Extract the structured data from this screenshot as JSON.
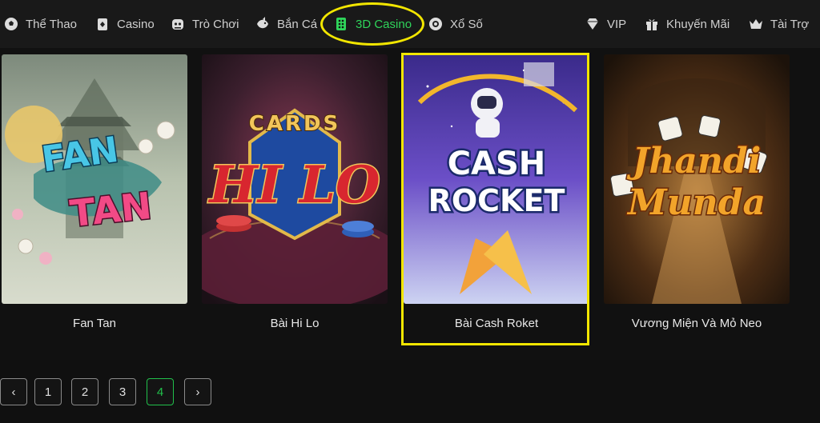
{
  "nav": {
    "items": [
      {
        "label": "Thể Thao",
        "icon": "soccer-ball-icon"
      },
      {
        "label": "Casino",
        "icon": "cards-icon"
      },
      {
        "label": "Trò Chơi",
        "icon": "gamepad-icon"
      },
      {
        "label": "Bắn Cá",
        "icon": "fish-icon"
      },
      {
        "label": "3D Casino",
        "icon": "dice-icon",
        "active": true
      },
      {
        "label": "Xổ Số",
        "icon": "lottery-ball-icon"
      }
    ],
    "right_items": [
      {
        "label": "VIP",
        "icon": "diamond-icon"
      },
      {
        "label": "Khuyến Mãi",
        "icon": "gift-icon"
      },
      {
        "label": "Tài Trợ",
        "icon": "crown-icon"
      }
    ]
  },
  "games": [
    {
      "name": "Fan Tan",
      "art_title": "FAN TAN"
    },
    {
      "name": "Bài Hi Lo",
      "art_title_top": "CARDS",
      "art_title": "HI LO"
    },
    {
      "name": "Bài Cash Roket",
      "art_title": "CASH ROCKET",
      "selected": true
    },
    {
      "name": "Vương Miện Và Mỏ Neo",
      "art_title": "Jhandi Munda"
    }
  ],
  "pagination": {
    "prev": "‹",
    "pages": [
      "1",
      "2",
      "3",
      "4"
    ],
    "current": "4",
    "next": "›"
  },
  "colors": {
    "accent_green": "#2fd35a",
    "annotation_yellow": "#f2e600"
  }
}
